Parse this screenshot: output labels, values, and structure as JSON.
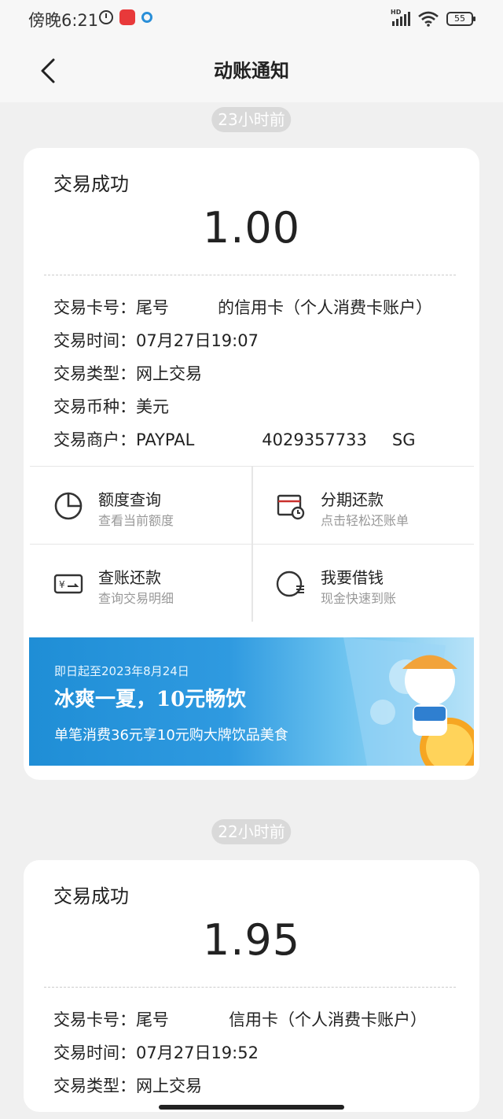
{
  "status_bar": {
    "time": "傍晚6:21",
    "battery": "55",
    "network": "HD"
  },
  "header": {
    "title": "动账通知"
  },
  "notifications": [
    {
      "time_ago": "23小时前",
      "status": "交易成功",
      "amount": "1.00",
      "details": [
        {
          "label": "交易卡号：",
          "value": "尾号",
          "value_tail": "的信用卡（个人消费卡账户）"
        },
        {
          "label": "交易时间：",
          "value": "07月27日19:07"
        },
        {
          "label": "交易类型：",
          "value": "网上交易"
        },
        {
          "label": "交易币种：",
          "value": "美元"
        },
        {
          "label": "交易商户：",
          "value": "PAYPAL",
          "value_2": "4029357733",
          "value_3": "SG"
        }
      ],
      "actions": [
        {
          "title": "额度查询",
          "subtitle": "查看当前额度",
          "icon": "pie-chart-icon"
        },
        {
          "title": "分期还款",
          "subtitle": "点击轻松还账单",
          "icon": "installment-icon"
        },
        {
          "title": "查账还款",
          "subtitle": "查询交易明细",
          "icon": "bill-card-icon"
        },
        {
          "title": "我要借钱",
          "subtitle": "现金快速到账",
          "icon": "borrow-icon"
        }
      ],
      "banner": {
        "line1": "即日起至2023年8月24日",
        "line2": "冰爽一夏，10元畅饮",
        "line3": "单笔消费36元享10元购大牌饮品美食"
      }
    },
    {
      "time_ago": "22小时前",
      "status": "交易成功",
      "amount": "1.95",
      "details": [
        {
          "label": "交易卡号：",
          "value": "尾号",
          "value_tail": "信用卡（个人消费卡账户）"
        },
        {
          "label": "交易时间：",
          "value": "07月27日19:52"
        },
        {
          "label": "交易类型：",
          "value": "网上交易"
        }
      ]
    }
  ]
}
